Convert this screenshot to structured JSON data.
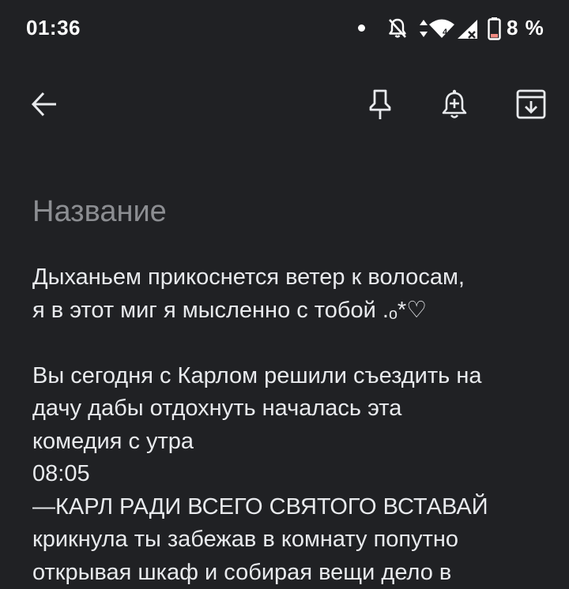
{
  "status_bar": {
    "time": "01:36",
    "battery_percent": "8 %",
    "icons": [
      "notification-dot-icon",
      "bell-off-icon",
      "data-arrows-icon",
      "wifi-icon",
      "cell-signal-icon",
      "battery-low-icon"
    ]
  },
  "toolbar": {
    "icons": [
      "back-arrow-icon",
      "pin-icon",
      "add-reminder-icon",
      "archive-icon"
    ]
  },
  "note": {
    "title_placeholder": "Название",
    "body_lines": [
      "Дыханьем прикоснется ветер к волосам,",
      "я в этот миг я мысленно с тобой .ₒ*♡",
      "",
      "Вы сегодня с Карлом решили съездить на",
      "дачу дабы отдохнуть началась эта",
      "комедия с утра",
      "08:05",
      "—КАРЛ РАДИ ВСЕГО СВЯТОГО ВСТАВАЙ",
      "крикнула ты забежав в комнату попутно",
      "открывая шкаф и собирая вещи дело в"
    ]
  },
  "colors": {
    "background": "#202124",
    "text": "#e8eaed",
    "placeholder": "#8c8e92",
    "icon": "#e8eaed",
    "battery_low": "#f28b82"
  }
}
